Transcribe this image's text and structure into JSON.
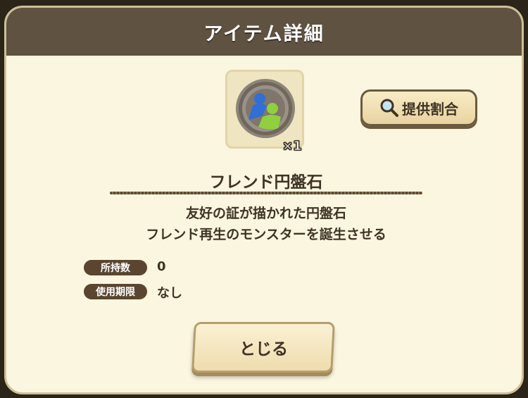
{
  "dialog": {
    "title": "アイテム詳細"
  },
  "item": {
    "icon": "friend-coin-icon",
    "quantity_label": "×1",
    "name": "フレンド円盤石",
    "description_line1": "友好の証が描かれた円盤石",
    "description_line2": "フレンド再生のモンスターを誕生させる"
  },
  "rates_button": {
    "label": "提供割合",
    "icon": "magnifier-icon"
  },
  "stats": {
    "owned_label": "所持数",
    "owned_value": "0",
    "expiry_label": "使用期限",
    "expiry_value": "なし"
  },
  "close_button": {
    "label": "とじる"
  },
  "colors": {
    "title_bar": "#5f5241",
    "panel": "#fbf6df",
    "text": "#3e3325",
    "badge": "#5a4630",
    "coin_blue": "#2f6fd6",
    "coin_green": "#8fd13a"
  }
}
